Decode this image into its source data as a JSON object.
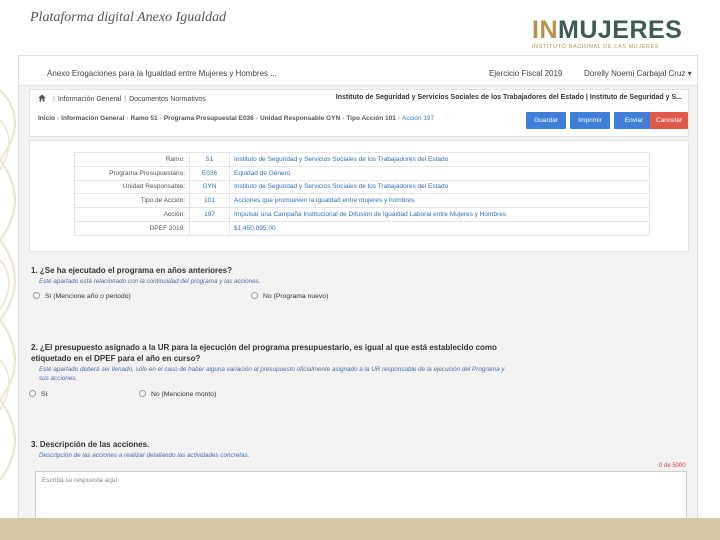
{
  "slide": {
    "title": "Plataforma digital Anexo Igualdad",
    "logo": {
      "main_a": "IN",
      "main_b": "MUJERES",
      "sub": "INSTITUTO NACIONAL DE LAS MUJERES"
    },
    "colors": {
      "gold": "#b8924a",
      "green": "#3e5b56",
      "band": "#d7c7a3"
    }
  },
  "header": {
    "app_name": "Anexo Erogaciones para la Igualdad entre Mujeres y Hombres ...",
    "fiscal_year": "Ejercicio Fiscal 2019",
    "user": "Dorelly Noemi Carbajal Cruz"
  },
  "breadcrumb_top": {
    "items": [
      "Información General",
      "Documentos Normativos"
    ],
    "institution": "Instituto de Seguridad y Servicios Sociales de los Trabajadores del Estado | Instituto de Seguridad y S..."
  },
  "breadcrumb_path": {
    "items": [
      "Inicio",
      "Información General",
      "Ramo 51",
      "Programa Presupuestal E036",
      "Unidad Responsable GYN",
      "Tipo Acción 101"
    ],
    "active": "Acción 197"
  },
  "toolbar": {
    "save": "Guardar",
    "print": "Imprimir",
    "send": "Enviar",
    "cancel": "Cancelar",
    "colors": {
      "primary": "#3f7fd8",
      "danger": "#e05a4b"
    }
  },
  "details": [
    {
      "label": "Ramo:",
      "code": "51",
      "desc": "Instituto de Seguridad y Servicios Sociales de los Trabajadores del Estado"
    },
    {
      "label": "Programa Presupuestario:",
      "code": "E036",
      "desc": "Equidad de Género"
    },
    {
      "label": "Unidad Responsable:",
      "code": "GYN",
      "desc": "Instituto de Seguridad y Servicios Sociales de los Trabajadores del Estado"
    },
    {
      "label": "Tipo de Acción:",
      "code": "101",
      "desc": "Acciones que promueven la igualdad entre mujeres y hombres"
    },
    {
      "label": "Acción:",
      "code": "197",
      "desc": "Impulsar una Campaña Institucional de Difusión de Igualdad Laboral entre Mujeres y Hombres"
    },
    {
      "label": "DPEF 2019:",
      "code": "",
      "desc": "$1,450,095.00"
    }
  ],
  "q1": {
    "title": "1. ¿Se ha ejecutado el programa en años anteriores?",
    "hint": "Este apartado está relacionado con la continuidad del programa y las acciones.",
    "opt_yes": "Sí (Mencione año o periodo)",
    "opt_no": "No (Programa nuevo)"
  },
  "q2": {
    "title_line1": "2. ¿El presupuesto asignado a la UR para la ejecución del programa presupuestario, es igual al que está establecido como",
    "title_line2": "etiquetado en el DPEF para el año en curso?",
    "hint_line1": "Este apartado deberá ser llenado, sólo en el caso de haber alguna variación al presupuesto oficialmente asignado a la UR responsable de la ejecución del Programa y",
    "hint_line2": "sus acciones.",
    "opt_yes": "Sí",
    "opt_no": "No (Mencione monto)"
  },
  "q3": {
    "title": "3. Descripción de las acciones.",
    "hint": "Descripción de las acciones a realizar detallando las actividades concretas.",
    "counter": "0 de 5000",
    "placeholder": "Escriba su respuesta aquí"
  }
}
